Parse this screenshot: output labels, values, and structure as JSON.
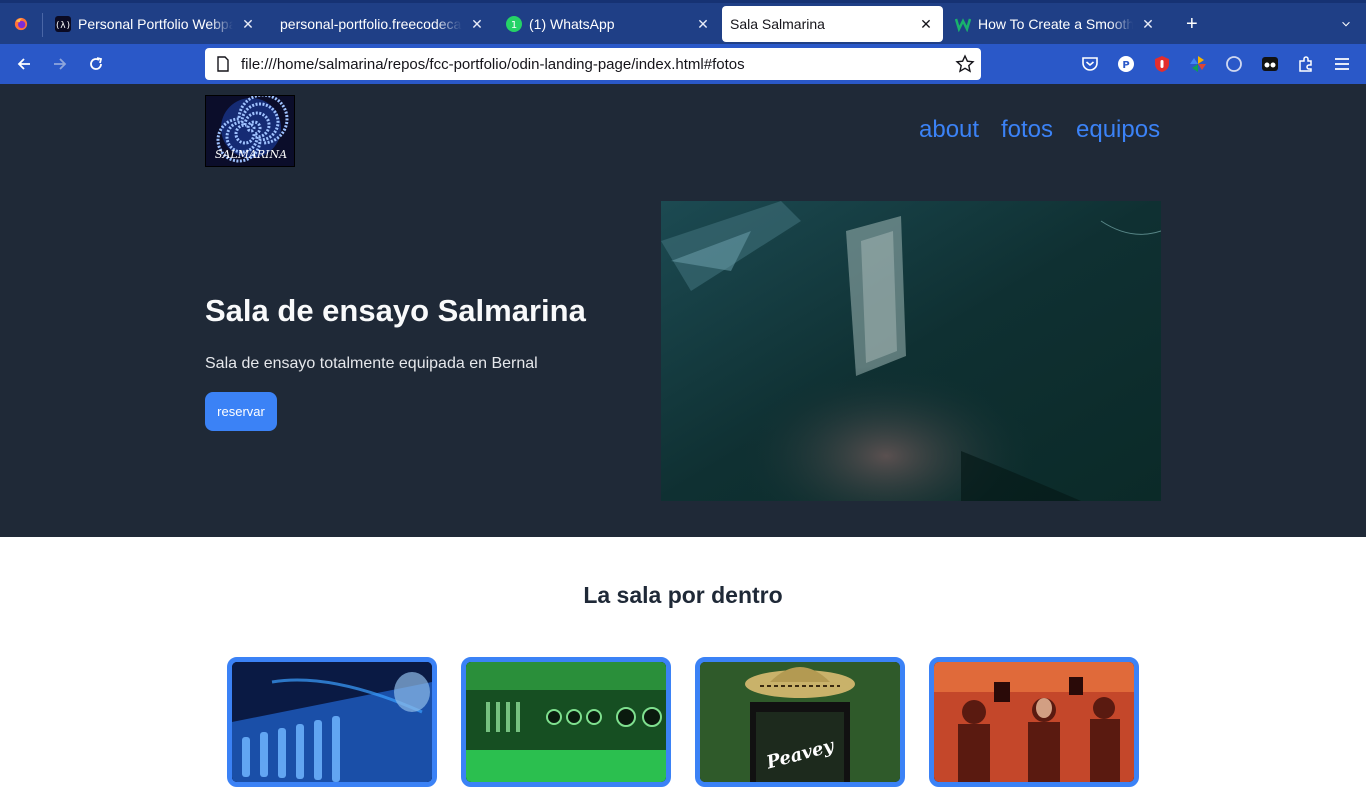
{
  "browser": {
    "tabs": [
      {
        "title": "Personal Portfolio Webpage",
        "favicon": "freecodecamp-icon"
      },
      {
        "title": "personal-portfolio.freecodecamp",
        "favicon": ""
      },
      {
        "title": "(1) WhatsApp",
        "favicon": "whatsapp-icon",
        "badge": "1"
      },
      {
        "title": "Sala Salmarina",
        "favicon": "",
        "active": true
      },
      {
        "title": "How To Create a Smooth Scroll",
        "favicon": "w-icon"
      }
    ],
    "url": "file:///home/salmarina/repos/fcc-portfolio/odin-landing-page/index.html#fotos"
  },
  "site": {
    "logo_text": "SALMARINA",
    "nav": [
      "about",
      "fotos",
      "equipos"
    ],
    "hero": {
      "title": "Sala de ensayo Salmarina",
      "subtitle": "Sala de ensayo totalmente equipada en Bernal",
      "button": "reservar"
    },
    "gallery": {
      "title": "La sala por dentro",
      "cards": [
        {
          "name": "mixer-photo"
        },
        {
          "name": "amplifier-photo"
        },
        {
          "name": "peavey-amp-photo",
          "text": "Peavey"
        },
        {
          "name": "band-photo"
        }
      ]
    }
  },
  "colors": {
    "tab_bar": "#1f3f86",
    "toolbar": "#2a58c8",
    "hero_bg": "#1f2937",
    "accent": "#3b82f6"
  }
}
